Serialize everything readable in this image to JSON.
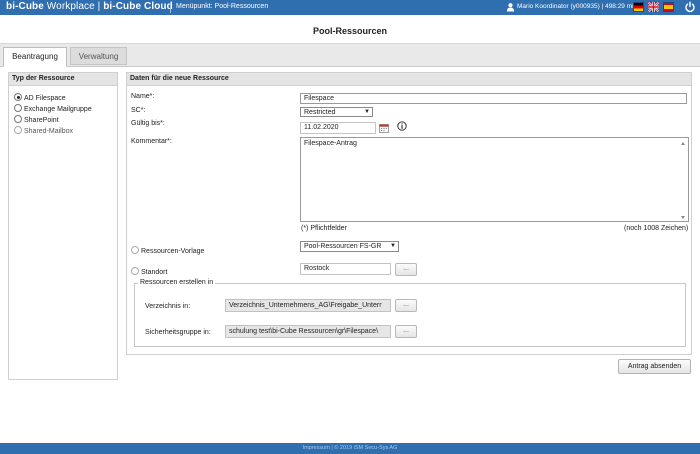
{
  "topbar": {
    "brand_part1": "bi-Cube",
    "brand_part2": " Workplace | ",
    "brand_part3": "bi-Cube Cloud",
    "menu_label": "Menüpunkt: Pool-Ressourcen",
    "user_info": "Mario Koordinator (y000935) | 498:29 min",
    "languages": [
      "de",
      "en",
      "es"
    ],
    "power_icon": "power-icon",
    "user_icon": "user-icon"
  },
  "page": {
    "title": "Pool-Ressourcen"
  },
  "tabs": [
    {
      "label": "Beantragung",
      "active": true
    },
    {
      "label": "Verwaltung",
      "active": false
    }
  ],
  "resource_type": {
    "heading": "Typ der Ressource",
    "options": [
      {
        "label": "AD Filespace",
        "checked": true
      },
      {
        "label": "Exchange Mailgruppe",
        "checked": false
      },
      {
        "label": "SharePoint",
        "checked": false
      },
      {
        "label": "Shared-Mailbox",
        "checked": false
      }
    ]
  },
  "form": {
    "heading": "Daten für die neue Ressource",
    "name_label": "Name*:",
    "name_value": "Filespace",
    "sc_label": "SC*:",
    "sc_value": "Restricted",
    "valid_label": "Gültig bis*:",
    "valid_value": "11.02.2020",
    "comment_label": "Kommentar*:",
    "comment_value": "Filespace-Antrag",
    "required_note": "(*) Pflichtfelder",
    "chars_left": "(noch 1008 Zeichen)",
    "template_label": "Ressourcen-Vorlage",
    "template_value": "Pool-Ressourcen FS-GR",
    "location_label": "Standort",
    "location_value": "Rostock",
    "dots": "...",
    "create_group_label": "Ressourcen erstellen in",
    "directory_label": "Verzeichnis in:",
    "directory_value": "Verzeichnis_Unternehmens_AG\\Freigabe_Unterr",
    "security_label": "Sicherheitsgruppe in:",
    "security_value": "schulung test\\bi-Cube Ressourcen\\gr\\Filespace\\",
    "submit_label": "Antrag absenden"
  },
  "footer": {
    "text": "Impressum | © 2019 iSM Secu-Sys AG"
  },
  "colors": {
    "brand_blue": "#2f6fb0"
  }
}
